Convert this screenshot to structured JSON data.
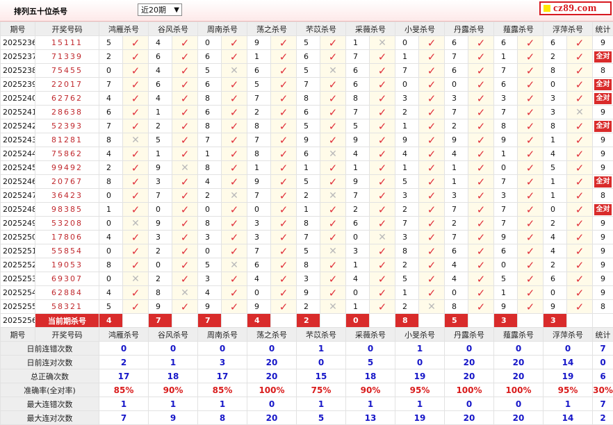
{
  "page": {
    "title": "排列五十位杀号",
    "period_select": "近20期",
    "logo": "cz89.com"
  },
  "columns": [
    "鸿雁杀号",
    "谷风杀号",
    "周南杀号",
    "荡之杀号",
    "芣苡杀号",
    "采薇杀号",
    "小旻杀号",
    "丹露杀号",
    "薤露杀号",
    "浮萍杀号"
  ],
  "headers": {
    "issue": "期号",
    "nums": "开奖号码",
    "stat": "统计"
  },
  "rows": [
    {
      "issue": "2025236",
      "nums": "15111",
      "vals": [
        5,
        4,
        0,
        9,
        5,
        1,
        0,
        6,
        6,
        6
      ],
      "ok": [
        1,
        1,
        1,
        1,
        1,
        0,
        1,
        1,
        1,
        1
      ],
      "stat": "9"
    },
    {
      "issue": "2025237",
      "nums": "71339",
      "vals": [
        2,
        6,
        6,
        1,
        6,
        7,
        1,
        7,
        1,
        2
      ],
      "ok": [
        1,
        1,
        1,
        1,
        1,
        1,
        1,
        1,
        1,
        1
      ],
      "stat": "全对"
    },
    {
      "issue": "2025238",
      "nums": "75455",
      "vals": [
        0,
        4,
        5,
        6,
        5,
        6,
        7,
        6,
        7,
        8
      ],
      "ok": [
        1,
        1,
        0,
        1,
        0,
        1,
        1,
        1,
        1,
        1
      ],
      "stat": "8"
    },
    {
      "issue": "2025239",
      "nums": "22017",
      "vals": [
        7,
        6,
        6,
        5,
        7,
        6,
        0,
        0,
        6,
        0
      ],
      "ok": [
        1,
        1,
        1,
        1,
        1,
        1,
        1,
        1,
        1,
        1
      ],
      "stat": "全对"
    },
    {
      "issue": "2025240",
      "nums": "62762",
      "vals": [
        4,
        4,
        8,
        7,
        8,
        8,
        3,
        3,
        3,
        3
      ],
      "ok": [
        1,
        1,
        1,
        1,
        1,
        1,
        1,
        1,
        1,
        1
      ],
      "stat": "全对"
    },
    {
      "issue": "2025241",
      "nums": "28638",
      "vals": [
        6,
        1,
        6,
        2,
        6,
        7,
        2,
        7,
        7,
        3
      ],
      "ok": [
        1,
        1,
        1,
        1,
        1,
        1,
        1,
        1,
        1,
        0
      ],
      "stat": "9"
    },
    {
      "issue": "2025242",
      "nums": "52393",
      "vals": [
        7,
        2,
        8,
        8,
        5,
        5,
        1,
        2,
        8,
        8
      ],
      "ok": [
        1,
        1,
        1,
        1,
        1,
        1,
        1,
        1,
        1,
        1
      ],
      "stat": "全对"
    },
    {
      "issue": "2025243",
      "nums": "81281",
      "vals": [
        8,
        5,
        7,
        7,
        9,
        9,
        9,
        9,
        9,
        1
      ],
      "ok": [
        0,
        1,
        1,
        1,
        1,
        1,
        1,
        1,
        1,
        1
      ],
      "stat": "9"
    },
    {
      "issue": "2025244",
      "nums": "75862",
      "vals": [
        4,
        1,
        1,
        8,
        6,
        4,
        4,
        4,
        1,
        4
      ],
      "ok": [
        1,
        1,
        1,
        1,
        0,
        1,
        1,
        1,
        1,
        1
      ],
      "stat": "9"
    },
    {
      "issue": "2025245",
      "nums": "99492",
      "vals": [
        2,
        9,
        8,
        1,
        1,
        1,
        1,
        1,
        0,
        5
      ],
      "ok": [
        1,
        0,
        1,
        1,
        1,
        1,
        1,
        1,
        1,
        1
      ],
      "stat": "9"
    },
    {
      "issue": "2025246",
      "nums": "20767",
      "vals": [
        8,
        3,
        4,
        9,
        5,
        9,
        5,
        1,
        7,
        1
      ],
      "ok": [
        1,
        1,
        1,
        1,
        1,
        1,
        1,
        1,
        1,
        1
      ],
      "stat": "全对"
    },
    {
      "issue": "2025247",
      "nums": "36423",
      "vals": [
        0,
        7,
        2,
        7,
        2,
        7,
        3,
        3,
        3,
        1
      ],
      "ok": [
        1,
        1,
        0,
        1,
        0,
        1,
        1,
        1,
        1,
        1
      ],
      "stat": "8"
    },
    {
      "issue": "2025248",
      "nums": "98385",
      "vals": [
        1,
        0,
        0,
        0,
        1,
        2,
        2,
        7,
        7,
        0
      ],
      "ok": [
        1,
        1,
        1,
        1,
        1,
        1,
        1,
        1,
        1,
        1
      ],
      "stat": "全对"
    },
    {
      "issue": "2025249",
      "nums": "53208",
      "vals": [
        0,
        9,
        8,
        3,
        8,
        6,
        7,
        2,
        7,
        2
      ],
      "ok": [
        0,
        1,
        1,
        1,
        1,
        1,
        1,
        1,
        1,
        1
      ],
      "stat": "9"
    },
    {
      "issue": "2025250",
      "nums": "17806",
      "vals": [
        4,
        3,
        3,
        3,
        7,
        0,
        3,
        7,
        9,
        4
      ],
      "ok": [
        1,
        1,
        1,
        1,
        1,
        0,
        1,
        1,
        1,
        1
      ],
      "stat": "9"
    },
    {
      "issue": "2025251",
      "nums": "55854",
      "vals": [
        0,
        2,
        0,
        7,
        5,
        3,
        8,
        6,
        6,
        4
      ],
      "ok": [
        1,
        1,
        1,
        1,
        0,
        1,
        1,
        1,
        1,
        1
      ],
      "stat": "9"
    },
    {
      "issue": "2025252",
      "nums": "19053",
      "vals": [
        8,
        0,
        5,
        6,
        8,
        1,
        2,
        4,
        0,
        2
      ],
      "ok": [
        1,
        1,
        0,
        1,
        1,
        1,
        1,
        1,
        1,
        1
      ],
      "stat": "9"
    },
    {
      "issue": "2025253",
      "nums": "69307",
      "vals": [
        0,
        2,
        3,
        4,
        3,
        4,
        5,
        4,
        5,
        6
      ],
      "ok": [
        0,
        1,
        1,
        1,
        1,
        1,
        1,
        1,
        1,
        1
      ],
      "stat": "9"
    },
    {
      "issue": "2025254",
      "nums": "62884",
      "vals": [
        4,
        8,
        4,
        0,
        9,
        0,
        1,
        0,
        1,
        0
      ],
      "ok": [
        1,
        0,
        1,
        1,
        1,
        1,
        1,
        1,
        1,
        1
      ],
      "stat": "9"
    },
    {
      "issue": "2025255",
      "nums": "58321",
      "vals": [
        5,
        9,
        9,
        9,
        2,
        1,
        2,
        8,
        9,
        9
      ],
      "ok": [
        1,
        1,
        1,
        1,
        0,
        1,
        0,
        1,
        1,
        1
      ],
      "stat": "8"
    }
  ],
  "current": {
    "issue": "2025256",
    "label": "当前期杀号",
    "vals": [
      "4",
      "7",
      "7",
      "4",
      "2",
      "0",
      "8",
      "5",
      "3",
      "3"
    ]
  },
  "summary": [
    {
      "label": "日前连错次数",
      "vals": [
        "0",
        "0",
        "0",
        "0",
        "1",
        "0",
        "1",
        "0",
        "0",
        "0"
      ],
      "stat": "7",
      "red": false
    },
    {
      "label": "日前连对次数",
      "vals": [
        "2",
        "1",
        "3",
        "20",
        "0",
        "5",
        "0",
        "20",
        "20",
        "14"
      ],
      "stat": "0",
      "red": false
    },
    {
      "label": "总正确次数",
      "vals": [
        "17",
        "18",
        "17",
        "20",
        "15",
        "18",
        "19",
        "20",
        "20",
        "19"
      ],
      "stat": "6",
      "red": false
    },
    {
      "label": "准确率(全对率)",
      "vals": [
        "85%",
        "90%",
        "85%",
        "100%",
        "75%",
        "90%",
        "95%",
        "100%",
        "100%",
        "95%"
      ],
      "stat": "30%",
      "red": true
    },
    {
      "label": "最大连错次数",
      "vals": [
        "1",
        "1",
        "1",
        "0",
        "1",
        "1",
        "1",
        "0",
        "0",
        "1"
      ],
      "stat": "7",
      "red": false
    },
    {
      "label": "最大连对次数",
      "vals": [
        "7",
        "9",
        "8",
        "20",
        "5",
        "13",
        "19",
        "20",
        "20",
        "14"
      ],
      "stat": "2",
      "red": false
    }
  ],
  "colors": {
    "accent": "#d92b2b",
    "check": "#e0303a",
    "blue": "#1616c8",
    "header_bg": "#eeeeee",
    "mark_bg": "#fffbe9"
  },
  "icons": {
    "check": "check-icon",
    "cross": "cross-icon"
  }
}
